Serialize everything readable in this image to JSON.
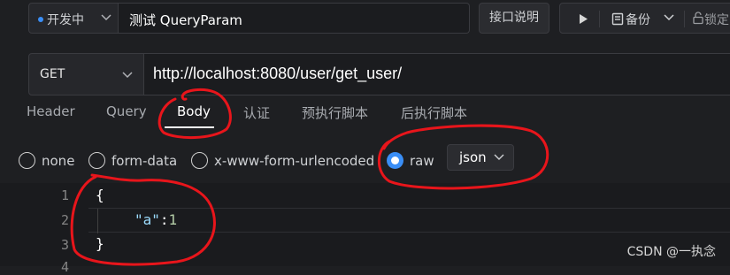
{
  "topbar": {
    "status": "开发中",
    "request_name": "测试 QueryParam",
    "doc_button": "接口说明",
    "backup_label": "备份",
    "lock_label": "锁定"
  },
  "request": {
    "method": "GET",
    "url": "http://localhost:8080/user/get_user/"
  },
  "tabs": [
    "Header",
    "Query",
    "Body",
    "认证",
    "预执行脚本",
    "后执行脚本"
  ],
  "active_tab": "Body",
  "body_types": [
    "none",
    "form-data",
    "x-www-form-urlencoded",
    "raw"
  ],
  "selected_body_type": "raw",
  "raw_format": "json",
  "editor": {
    "line_numbers": [
      "1",
      "2",
      "3",
      "4"
    ],
    "line1": "{",
    "key": "\"a\"",
    "colon": ":",
    "value": "1",
    "line3": "}"
  },
  "watermark": "CSDN @一执念",
  "colors": {
    "accent": "#3a8ef6",
    "annotation": "#e8151b",
    "background": "#1e1f22"
  }
}
